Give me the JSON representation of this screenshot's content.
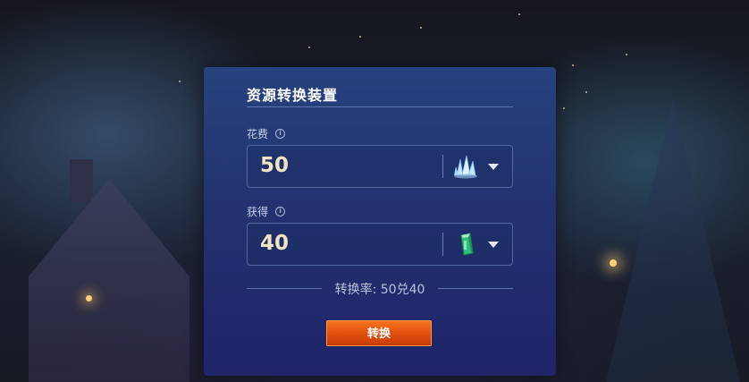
{
  "panel": {
    "title": "资源转换装置",
    "cost": {
      "label": "花费",
      "info_icon": "info-icon",
      "value": "50",
      "resource_icon": "crystal-icon"
    },
    "gain": {
      "label": "获得",
      "info_icon": "info-icon",
      "value": "40",
      "resource_icon": "green-gem-icon"
    },
    "rate_text": "转换率: 50兑40",
    "convert_label": "转换"
  },
  "colors": {
    "panel_top": "#27427e",
    "panel_bottom": "#202469",
    "button": "#e4561a",
    "value_text": "#f0e4c4"
  }
}
